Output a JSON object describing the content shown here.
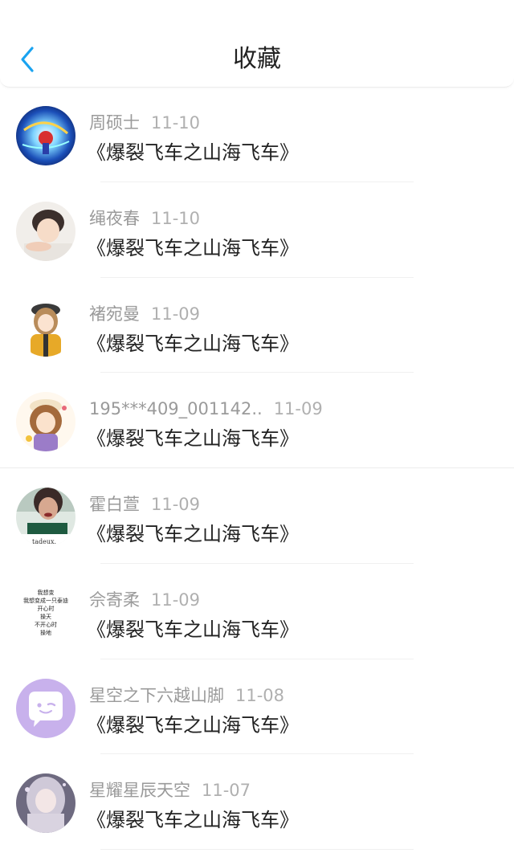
{
  "header": {
    "title": "收藏",
    "back_icon": "chevron-left-icon",
    "accent_color": "#1aa3f0"
  },
  "favorites": [
    {
      "name": "周硕士",
      "date": "11-10",
      "text": "《爆裂飞车之山海飞车》"
    },
    {
      "name": "绳夜春",
      "date": "11-10",
      "text": "《爆裂飞车之山海飞车》"
    },
    {
      "name": "褚宛曼",
      "date": "11-09",
      "text": "《爆裂飞车之山海飞车》"
    },
    {
      "name": "195***409_001142..",
      "date": "11-09",
      "text": "《爆裂飞车之山海飞车》"
    },
    {
      "name": "霍白萱",
      "date": "11-09",
      "text": "《爆裂飞车之山海飞车》"
    },
    {
      "name": "佘寄柔",
      "date": "11-09",
      "text": "《爆裂飞车之山海飞车》",
      "avatar_text": [
        "我想变",
        "我想变成一只泰迪",
        "开心时",
        "操天",
        "不开心时",
        "操地"
      ]
    },
    {
      "name": "星空之下六越山脚",
      "date": "11-08",
      "text": "《爆裂飞车之山海飞车》"
    },
    {
      "name": "星耀星辰天空",
      "date": "11-07",
      "text": "《爆裂飞车之山海飞车》"
    }
  ]
}
